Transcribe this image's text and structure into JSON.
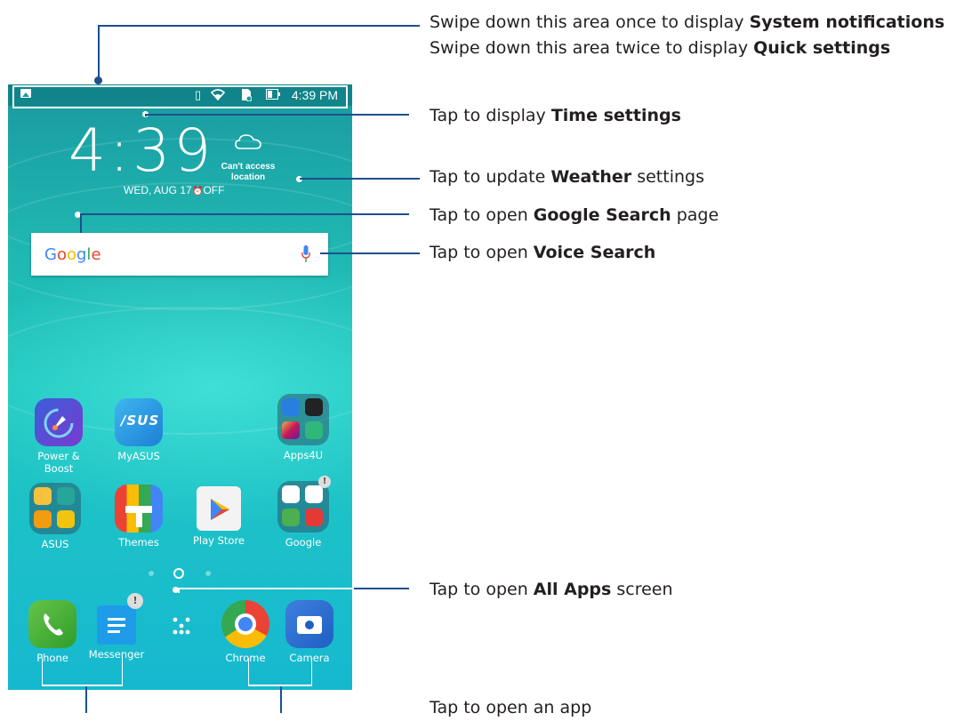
{
  "status_bar": {
    "time": "4:39 PM"
  },
  "clock": {
    "time": "4:39",
    "date": "WED, AUG 17",
    "alarm": "OFF"
  },
  "weather": {
    "line1": "Can't access",
    "line2": "location"
  },
  "search": {
    "logo": "Google"
  },
  "apps_row1": [
    {
      "label": "Power & Boost",
      "icon": "power-boost-icon"
    },
    {
      "label": "MyASUS",
      "icon": "myasus-icon"
    },
    {
      "label": "Apps4U",
      "icon": "apps4u-folder-icon"
    }
  ],
  "apps_row2": [
    {
      "label": "ASUS",
      "icon": "asus-folder-icon"
    },
    {
      "label": "Themes",
      "icon": "themes-icon"
    },
    {
      "label": "Play Store",
      "icon": "play-store-icon"
    },
    {
      "label": "Google",
      "icon": "google-folder-icon"
    }
  ],
  "dock": [
    {
      "label": "Phone",
      "icon": "phone-icon"
    },
    {
      "label": "Messenger",
      "icon": "messenger-icon"
    },
    {
      "label": "",
      "icon": "all-apps-icon"
    },
    {
      "label": "Chrome",
      "icon": "chrome-icon"
    },
    {
      "label": "Camera",
      "icon": "camera-icon"
    }
  ],
  "annotations": {
    "notifications": {
      "pre": "Swipe down this area once to display ",
      "bold": "System notifications",
      "post": ""
    },
    "quick": {
      "pre": "Swipe down this area twice to display ",
      "bold": "Quick settings",
      "post": ""
    },
    "time": {
      "pre": "Tap to display ",
      "bold": "Time settings",
      "post": ""
    },
    "weather": {
      "pre": "Tap to update ",
      "bold": "Weather",
      "post": " settings"
    },
    "google_search": {
      "pre": "Tap to open ",
      "bold": "Google Search",
      "post": " page"
    },
    "voice_search": {
      "pre": "Tap to open ",
      "bold": "Voice Search",
      "post": ""
    },
    "all_apps": {
      "pre": "Tap to open ",
      "bold": "All Apps",
      "post": " screen"
    },
    "open_app": {
      "pre": "Tap to open an app",
      "bold": "",
      "post": ""
    }
  },
  "colors": {
    "callout_line": "#1d4f8c",
    "screen_teal": "#21c9c0"
  }
}
